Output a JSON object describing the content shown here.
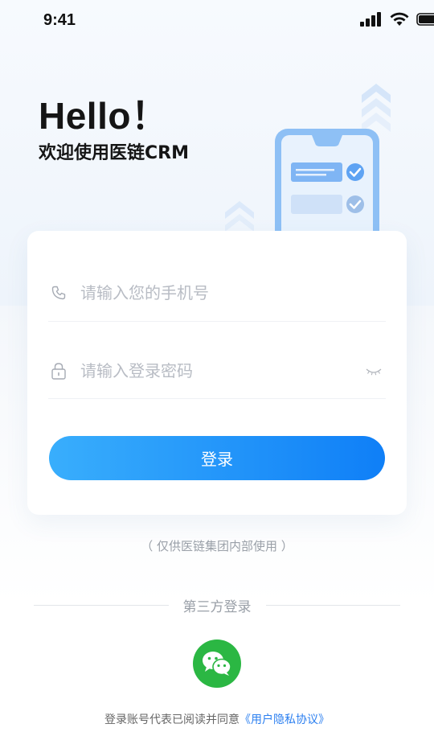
{
  "status_bar": {
    "time": "9:41"
  },
  "hero": {
    "title": "Hello！",
    "subtitle": "欢迎使用医链CRM"
  },
  "form": {
    "phone_placeholder": "请输入您的手机号",
    "password_placeholder": "请输入登录密码",
    "login_label": "登录"
  },
  "note": "（ 仅供医链集团内部使用 ）",
  "third_party": {
    "label": "第三方登录",
    "wechat_icon": "wechat-icon"
  },
  "agreement": {
    "text": "登录账号代表已阅读并同意",
    "link": "《用户隐私协议》"
  },
  "colors": {
    "primary": "#1485f7",
    "wechat": "#2bb743",
    "link": "#2b7ff0"
  }
}
